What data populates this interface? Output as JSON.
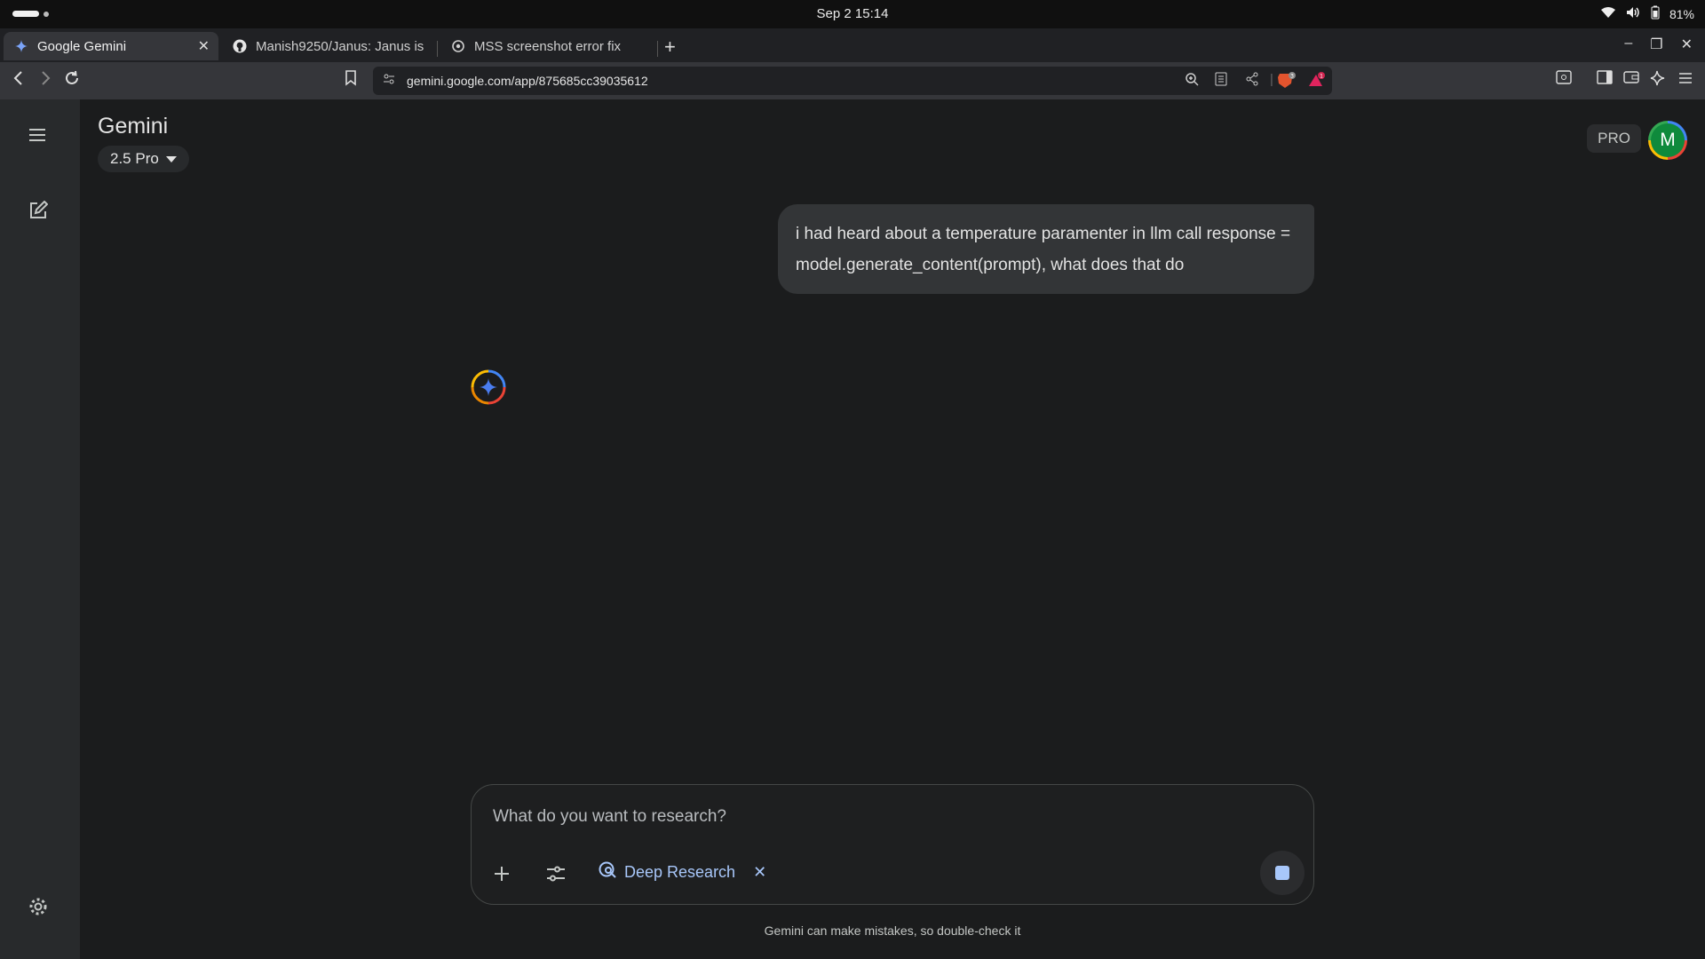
{
  "system": {
    "clock": "Sep 2  15:14",
    "battery": "81%"
  },
  "tabs": [
    {
      "title": "Google Gemini",
      "icon": "gemini-icon",
      "active": true
    },
    {
      "title": "Manish9250/Janus: Janus is a",
      "icon": "github-icon",
      "active": false
    },
    {
      "title": "MSS screenshot error fix",
      "icon": "openai-icon",
      "active": false
    }
  ],
  "browser": {
    "url": "gemini.google.com/app/875685cc39035612",
    "brave_badge": "3",
    "rewards_badge": "1"
  },
  "app": {
    "title": "Gemini",
    "model": "2.5 Pro",
    "pro_badge": "PRO",
    "avatar_initial": "M"
  },
  "conversation": {
    "user_message": "i had heard about a temperature paramenter in llm call response = model.generate_content(prompt), what does that do"
  },
  "composer": {
    "placeholder": "What do you want to research?",
    "tool_chip": "Deep Research"
  },
  "footer": {
    "disclaimer": "Gemini can make mistakes, so double-check it"
  },
  "colors": {
    "background": "#1b1c1d",
    "sidebar": "#282a2c",
    "bubble": "#333537",
    "accent": "#a8c7fa"
  }
}
